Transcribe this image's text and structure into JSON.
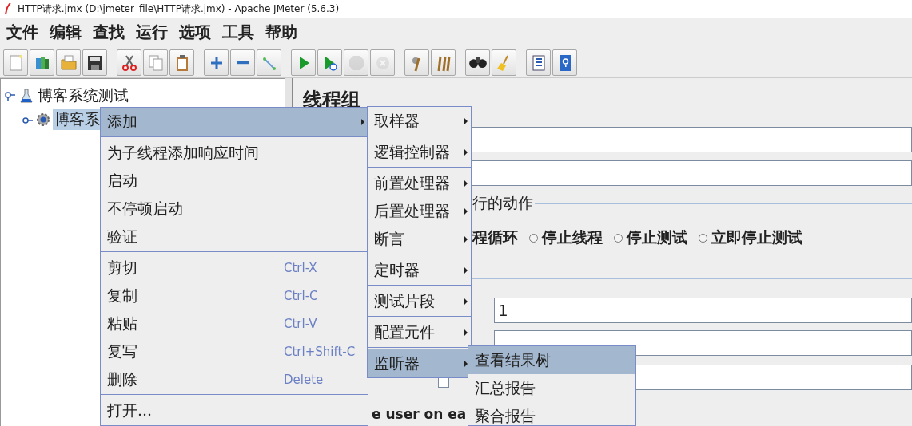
{
  "window": {
    "title": "HTTP请求.jmx (D:\\jmeter_file\\HTTP请求.jmx) - Apache JMeter (5.6.3)"
  },
  "menu_bar": [
    "文件",
    "编辑",
    "查找",
    "运行",
    "选项",
    "工具",
    "帮助"
  ],
  "toolbar": {
    "groups": [
      {
        "buttons": [
          {
            "disabled": false
          },
          {
            "disabled": false
          },
          {
            "disabled": false
          },
          {
            "disabled": false
          }
        ]
      },
      {
        "buttons": [
          {
            "disabled": false
          },
          {
            "disabled": false
          },
          {
            "disabled": false
          }
        ]
      },
      {
        "buttons": [
          {
            "disabled": false
          },
          {
            "disabled": false
          },
          {
            "disabled": false
          }
        ]
      },
      {
        "buttons": [
          {
            "disabled": false
          },
          {
            "disabled": false
          },
          {
            "disabled": true
          },
          {
            "disabled": true
          }
        ]
      },
      {
        "buttons": [
          {
            "disabled": false
          },
          {
            "disabled": false
          }
        ]
      },
      {
        "buttons": [
          {
            "disabled": false
          },
          {
            "disabled": false
          }
        ]
      },
      {
        "buttons": [
          {
            "disabled": false
          },
          {
            "disabled": false
          }
        ]
      }
    ]
  },
  "tree": [
    {
      "label": "博客系统测试",
      "selected": false,
      "children": [
        {
          "label": "博客系",
          "selected": true
        }
      ]
    }
  ],
  "panel": {
    "title": "线程组",
    "action_legend": "行的动作",
    "partial_option": "程循环",
    "options": [
      {
        "label": "停止线程",
        "selected": false
      },
      {
        "label": "停止测试",
        "selected": false
      },
      {
        "label": "立即停止测试",
        "selected": false
      }
    ],
    "fields": [
      {
        "value": "1"
      }
    ],
    "checkbox": {
      "checked": false
    },
    "footer_text": "e user on ea"
  },
  "context_menu": {
    "groups": [
      {
        "items": [
          {
            "label": "添加",
            "selected": true,
            "has_submenu": true
          }
        ]
      },
      {
        "items": [
          {
            "label": "为子线程添加响应时间",
            "selected": false
          },
          {
            "label": "启动",
            "selected": false
          },
          {
            "label": "不停顿启动",
            "selected": false
          },
          {
            "label": "验证",
            "selected": false
          }
        ]
      },
      {
        "items": [
          {
            "label": "剪切",
            "shortcut": "Ctrl-X",
            "selected": false
          },
          {
            "label": "复制",
            "shortcut": "Ctrl-C",
            "selected": false
          },
          {
            "label": "粘贴",
            "shortcut": "Ctrl-V",
            "selected": false
          },
          {
            "label": "复写",
            "shortcut": "Ctrl+Shift-C",
            "selected": false
          },
          {
            "label": "删除",
            "shortcut": "Delete",
            "selected": false
          }
        ]
      },
      {
        "items": [
          {
            "label": "打开...",
            "selected": false
          }
        ]
      }
    ]
  },
  "add_submenu": {
    "groups": [
      {
        "items": [
          {
            "label": "取样器",
            "selected": false
          }
        ]
      },
      {
        "items": [
          {
            "label": "逻辑控制器",
            "selected": false
          }
        ]
      },
      {
        "items": [
          {
            "label": "前置处理器",
            "selected": false
          },
          {
            "label": "后置处理器",
            "selected": false
          },
          {
            "label": "断言",
            "selected": false
          }
        ]
      },
      {
        "items": [
          {
            "label": "定时器",
            "selected": false
          }
        ]
      },
      {
        "items": [
          {
            "label": "测试片段",
            "selected": false
          }
        ]
      },
      {
        "items": [
          {
            "label": "配置元件",
            "selected": false
          }
        ]
      },
      {
        "items": [
          {
            "label": "监听器",
            "selected": true
          }
        ]
      }
    ]
  },
  "listener_submenu": {
    "items": [
      {
        "label": "查看结果树",
        "selected": true
      },
      {
        "label": "汇总报告",
        "selected": false
      },
      {
        "label": "聚合报告",
        "selected": false
      }
    ]
  }
}
